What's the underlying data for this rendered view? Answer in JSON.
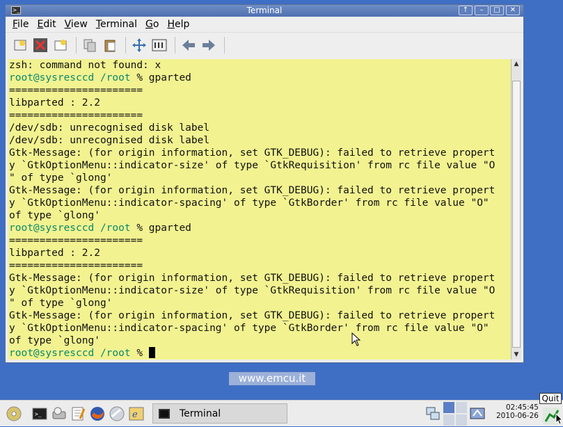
{
  "window": {
    "title": "Terminal",
    "controls": [
      "up-icon",
      "minimize-icon",
      "maximize-icon",
      "close-icon"
    ]
  },
  "menu": [
    "File",
    "Edit",
    "View",
    "Terminal",
    "Go",
    "Help"
  ],
  "toolbar": {
    "icons": [
      "new-tab-icon",
      "close-tab-icon",
      "new-window-icon",
      "copy-icon",
      "paste-icon",
      "fullscreen-icon",
      "preferences-icon",
      "back-icon",
      "forward-icon"
    ]
  },
  "terminal": {
    "background": "#f2f291",
    "lines": [
      {
        "text": "zsh: command not found: x"
      },
      {
        "user": "root@sysresccd",
        "path": " /root",
        "cmd": " % gparted"
      },
      {
        "text": "======================"
      },
      {
        "text": "libparted : 2.2"
      },
      {
        "text": "======================"
      },
      {
        "text": "/dev/sdb: unrecognised disk label"
      },
      {
        "text": "/dev/sdb: unrecognised disk label"
      },
      {
        "text": "Gtk-Message: (for origin information, set GTK_DEBUG): failed to retrieve propert"
      },
      {
        "text": "y `GtkOptionMenu::indicator-size' of type `GtkRequisition' from rc file value \"O"
      },
      {
        "text": "\" of type `glong'"
      },
      {
        "text": "Gtk-Message: (for origin information, set GTK_DEBUG): failed to retrieve propert"
      },
      {
        "text": "y `GtkOptionMenu::indicator-spacing' of type `GtkBorder' from rc file value \"O\""
      },
      {
        "text": "of type `glong'"
      },
      {
        "user": "root@sysresccd",
        "path": " /root",
        "cmd": " % gparted"
      },
      {
        "text": "======================"
      },
      {
        "text": "libparted : 2.2"
      },
      {
        "text": "======================"
      },
      {
        "text": "Gtk-Message: (for origin information, set GTK_DEBUG): failed to retrieve propert"
      },
      {
        "text": "y `GtkOptionMenu::indicator-size' of type `GtkRequisition' from rc file value \"O"
      },
      {
        "text": "\" of type `glong'"
      },
      {
        "text": "Gtk-Message: (for origin information, set GTK_DEBUG): failed to retrieve propert"
      },
      {
        "text": "y `GtkOptionMenu::indicator-spacing' of type `GtkBorder' from rc file value \"O\""
      },
      {
        "text": "of type `glong'"
      },
      {
        "user": "root@sysresccd",
        "path": " /root",
        "cmd": " % ",
        "cursor": true
      }
    ]
  },
  "watermark": "www.emcu.it",
  "taskbar": {
    "launchers": [
      "cd-icon",
      "terminal-icon",
      "disk-tool-icon",
      "text-editor-icon",
      "firefox-icon",
      "browser-icon",
      "ie-icon"
    ],
    "task_title": "Terminal",
    "tray": [
      "network-icon",
      "workspace-switcher",
      "tray-app-icon"
    ],
    "time": "02:45:45",
    "date": "2010-06-26",
    "quit_label": "Quit"
  }
}
